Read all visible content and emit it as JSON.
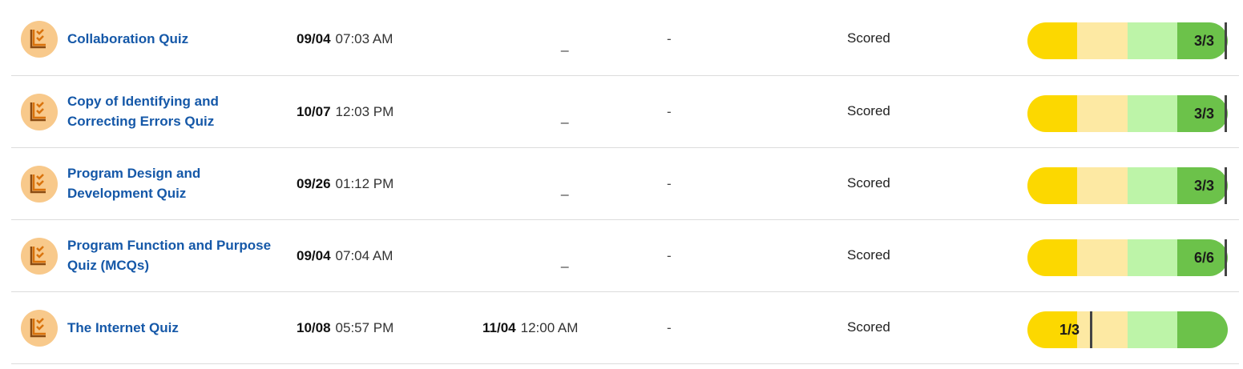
{
  "colors": {
    "link": "#1558a8",
    "icon_bg": "#f8c98b",
    "seg1": "#fcd800",
    "seg2": "#fde9a3",
    "seg3": "#bdf4a8",
    "seg4": "#6cc24a",
    "marker": "#444444"
  },
  "rows": [
    {
      "title_lines": [
        "Collaboration Quiz"
      ],
      "date": "09/04",
      "time": "07:03 AM",
      "due_date": "",
      "due_time": "",
      "due_placeholder": "_",
      "col4": "-",
      "status": "Scored",
      "score": "3/3",
      "fraction": 1.0
    },
    {
      "title_lines": [
        "Copy of Identifying and",
        "Correcting Errors Quiz"
      ],
      "date": "10/07",
      "time": "12:03 PM",
      "due_date": "",
      "due_time": "",
      "due_placeholder": "_",
      "col4": "-",
      "status": "Scored",
      "score": "3/3",
      "fraction": 1.0
    },
    {
      "title_lines": [
        "Program Design and",
        "Development Quiz"
      ],
      "date": "09/26",
      "time": "01:12 PM",
      "due_date": "",
      "due_time": "",
      "due_placeholder": "_",
      "col4": "-",
      "status": "Scored",
      "score": "3/3",
      "fraction": 1.0
    },
    {
      "title_lines": [
        "Program Function and Purpose",
        "Quiz (MCQs)"
      ],
      "date": "09/04",
      "time": "07:04 AM",
      "due_date": "",
      "due_time": "",
      "due_placeholder": "_",
      "col4": "-",
      "status": "Scored",
      "score": "6/6",
      "fraction": 1.0
    },
    {
      "title_lines": [
        "The Internet Quiz"
      ],
      "date": "10/08",
      "time": "05:57 PM",
      "due_date": "11/04",
      "due_time": "12:00 AM",
      "due_placeholder": "",
      "col4": "-",
      "status": "Scored",
      "score": "1/3",
      "fraction": 0.3333
    }
  ]
}
